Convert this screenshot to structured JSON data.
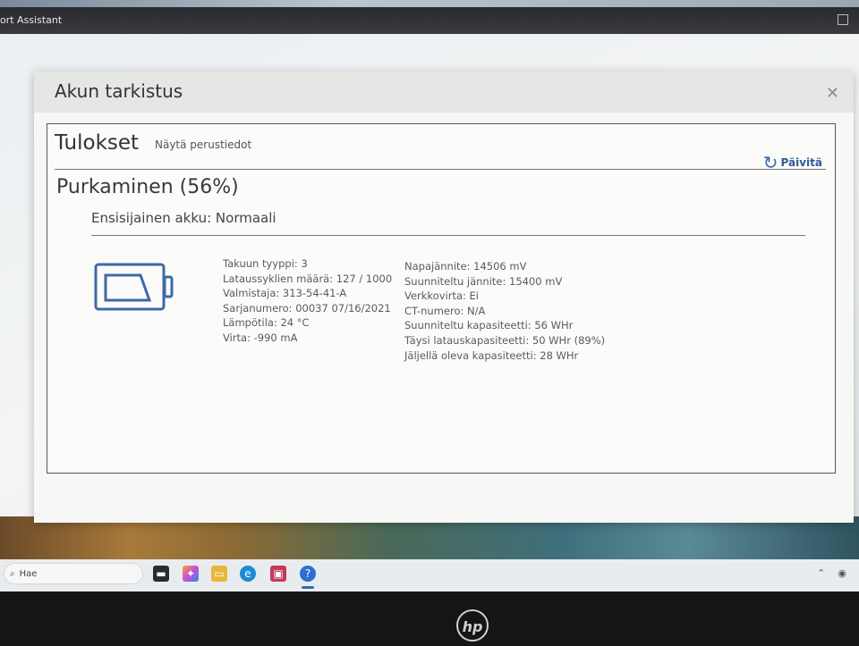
{
  "app": {
    "window_title": "ort Assistant"
  },
  "dialog": {
    "title": "Akun tarkistus",
    "close_icon": "close-icon"
  },
  "results": {
    "heading": "Tulokset",
    "show_basic_link": "Näytä perustiedot",
    "refresh_label": "Päivitä",
    "status": "Purkaminen (56%)",
    "battery_heading": "Ensisijainen akku: Normaali",
    "left_details": [
      "Takuun tyyppi: 3",
      "Lataussyklien määrä: 127 / 1000",
      "Valmistaja: 313-54-41-A",
      "Sarjanumero: 00037 07/16/2021",
      "Lämpötila: 24 °C",
      "Virta: -990 mA"
    ],
    "right_details": [
      "Napajännite: 14506 mV",
      "Suunniteltu jännite: 15400 mV",
      "Verkkovirta: Ei",
      "CT-numero: N/A",
      "Suunniteltu kapasiteetti: 56 WHr",
      "Täysi latauskapasiteetti: 50 WHr (89%)",
      "Jäljellä oleva kapasiteetti: 28 WHr"
    ]
  },
  "taskbar": {
    "search_placeholder": "Hae"
  },
  "colors": {
    "accent": "#3c6aa8",
    "battery_outline": "#3c6aa8"
  }
}
